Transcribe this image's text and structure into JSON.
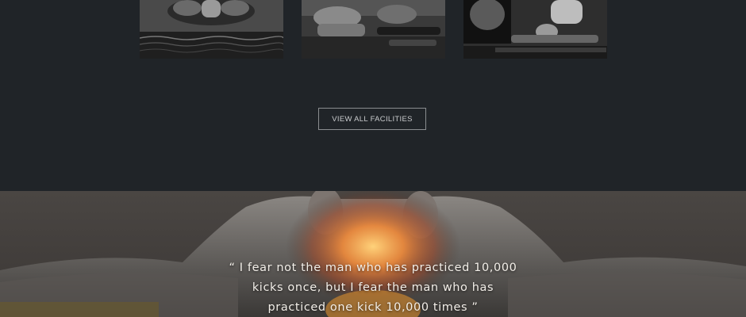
{
  "facilities": {
    "thumbnails": [
      {
        "icon": "swimming-photo"
      },
      {
        "icon": "yoga-class-photo"
      },
      {
        "icon": "pilates-photo"
      }
    ],
    "view_all_label": "VIEW ALL FACILITIES"
  },
  "quote": {
    "lines": [
      "“ I fear not the man who has practiced 10,000",
      "kicks once, but I fear the man who has",
      "practiced one kick 10,000 times ”"
    ]
  },
  "colors": {
    "background": "#202428",
    "button_border": "#8a8d90",
    "quote_text": "#f2eee8"
  }
}
